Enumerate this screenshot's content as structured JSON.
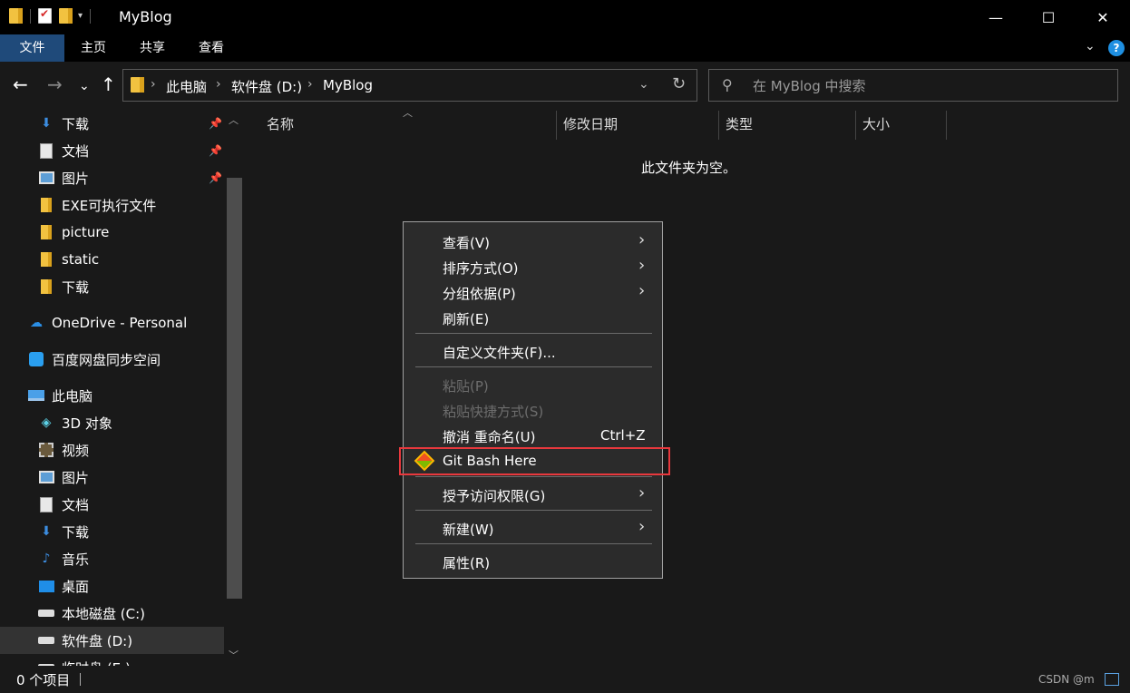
{
  "window": {
    "title": "MyBlog",
    "minimize": "—",
    "maximize": "☐",
    "close": "✕"
  },
  "ribbon": {
    "tabs": [
      {
        "label": "文件"
      },
      {
        "label": "主页"
      },
      {
        "label": "共享"
      },
      {
        "label": "查看"
      }
    ],
    "help": "?"
  },
  "address": {
    "crumbs": [
      "此电脑",
      "软件盘 (D:)",
      "MyBlog"
    ]
  },
  "search": {
    "placeholder": "在 MyBlog 中搜索"
  },
  "sidebar": {
    "items": [
      {
        "label": "下载",
        "icon": "download-icon"
      },
      {
        "label": "文档",
        "icon": "document-icon"
      },
      {
        "label": "图片",
        "icon": "pictures-icon"
      },
      {
        "label": "EXE可执行文件",
        "icon": "folder-icon"
      },
      {
        "label": "picture",
        "icon": "folder-icon"
      },
      {
        "label": "static",
        "icon": "folder-icon"
      },
      {
        "label": "下载",
        "icon": "folder-icon"
      },
      {
        "label": "OneDrive - Personal",
        "icon": "onedrive-icon"
      },
      {
        "label": "百度网盘同步空间",
        "icon": "baidu-netdisk-icon"
      },
      {
        "label": "此电脑",
        "icon": "this-pc-icon"
      },
      {
        "label": "3D 对象",
        "icon": "3d-objects-icon"
      },
      {
        "label": "视频",
        "icon": "videos-icon"
      },
      {
        "label": "图片",
        "icon": "pictures-icon"
      },
      {
        "label": "文档",
        "icon": "document-icon"
      },
      {
        "label": "下载",
        "icon": "download-icon"
      },
      {
        "label": "音乐",
        "icon": "music-icon"
      },
      {
        "label": "桌面",
        "icon": "desktop-icon"
      },
      {
        "label": "本地磁盘 (C:)",
        "icon": "local-disk-icon"
      },
      {
        "label": "软件盘 (D:)",
        "icon": "drive-icon"
      },
      {
        "label": "临时盘 (E:)",
        "icon": "drive-icon"
      }
    ]
  },
  "columns": {
    "name": "名称",
    "modified": "修改日期",
    "type": "类型",
    "size": "大小"
  },
  "content": {
    "empty_message": "此文件夹为空。"
  },
  "context_menu": {
    "items": [
      {
        "label": "查看(V)"
      },
      {
        "label": "排序方式(O)"
      },
      {
        "label": "分组依据(P)"
      },
      {
        "label": "刷新(E)"
      },
      {
        "label": "自定义文件夹(F)..."
      },
      {
        "label": "粘贴(P)"
      },
      {
        "label": "粘贴快捷方式(S)"
      },
      {
        "label": "撤消 重命名(U)",
        "shortcut": "Ctrl+Z"
      },
      {
        "label": "Git Bash Here"
      },
      {
        "label": "授予访问权限(G)"
      },
      {
        "label": "新建(W)"
      },
      {
        "label": "属性(R)"
      }
    ]
  },
  "status": {
    "item_count": "0 个项目",
    "watermark": "CSDN @m"
  },
  "colors": {
    "background": "#191919",
    "titlebar": "#000000",
    "active_tab": "#1f4a7a",
    "menu_bg": "#2b2b2b",
    "highlight_border": "#e8383d"
  }
}
